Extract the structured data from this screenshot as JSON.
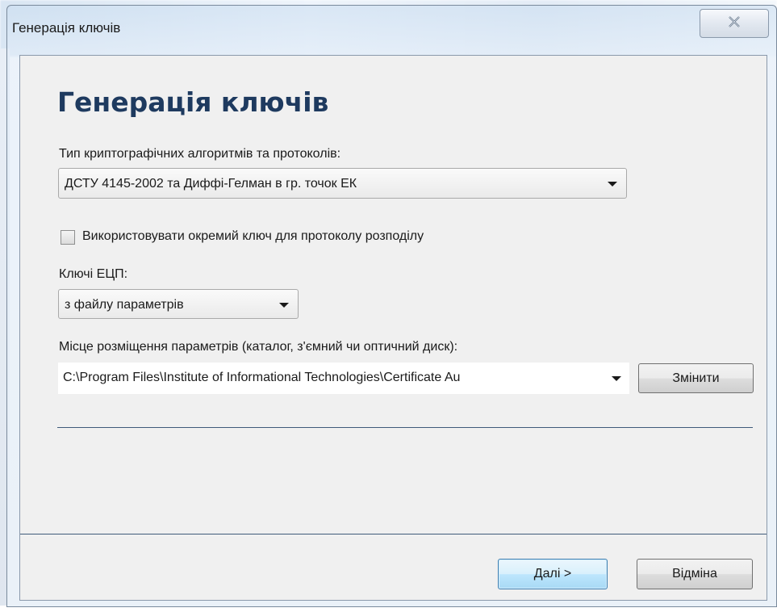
{
  "window": {
    "title": "Генерація ключів",
    "close_icon": "close-icon"
  },
  "page": {
    "heading": "Генерація ключів"
  },
  "crypto": {
    "label": "Тип криптографічних алгоритмів та протоколів:",
    "selected": "ДСТУ 4145-2002 та Диффі-Гелман в гр. точок ЕК"
  },
  "separate_key": {
    "label": "Використовувати окремий ключ для протоколу розподілу",
    "checked": false
  },
  "eds_keys": {
    "label": "Ключі ЕЦП:",
    "selected": "з файлу параметрів"
  },
  "params_location": {
    "label": "Місце розміщення параметрів (каталог, з'ємний чи оптичний диск):",
    "value": "C:\\Program Files\\Institute of Informational Technologies\\Certificate Au",
    "change_button": "Змінити"
  },
  "footer": {
    "next_button": "Далі >",
    "cancel_button": "Відміна"
  }
}
